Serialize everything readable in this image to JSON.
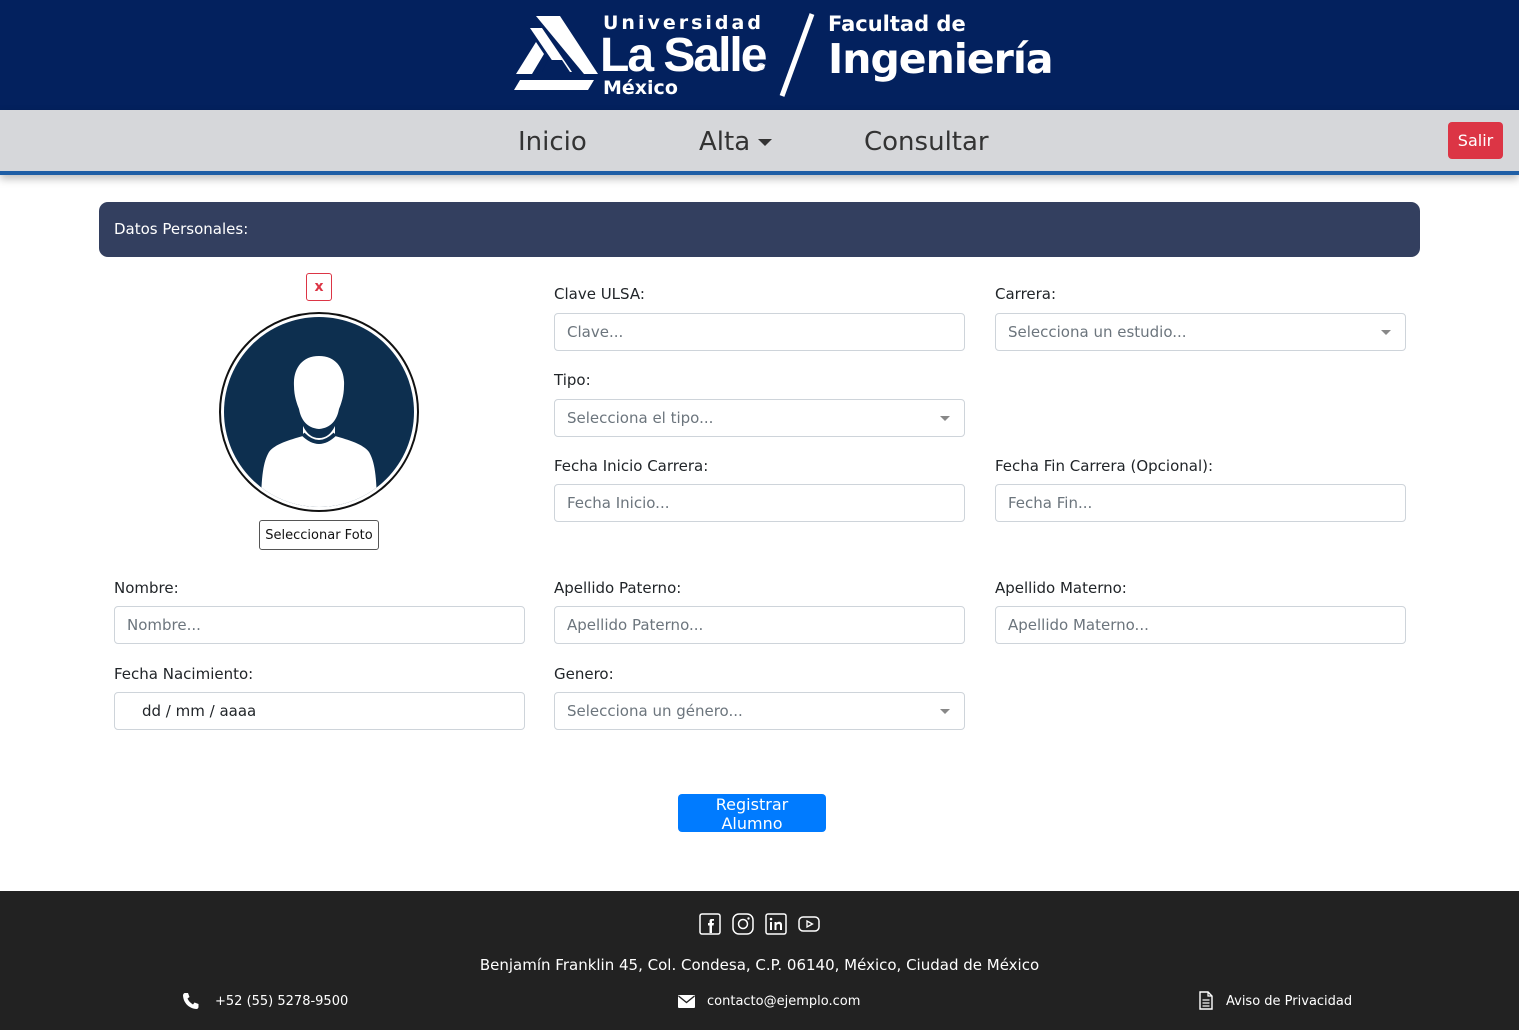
{
  "header": {
    "logo": {
      "universidad": "Universidad",
      "lasalle": "La Salle",
      "mexico": "México",
      "facultad": "Facultad de",
      "ingenieria": "Ingeniería"
    },
    "colors": {
      "background": "#03215e"
    }
  },
  "nav": {
    "items": [
      {
        "label": "Inicio"
      },
      {
        "label": "Alta",
        "has_dropdown": true
      },
      {
        "label": "Consultar"
      }
    ],
    "logout_label": "Salir"
  },
  "section": {
    "title": "Datos Personales:"
  },
  "photo": {
    "remove_label": "x",
    "select_label": "Seleccionar Foto",
    "avatar_icon": "user-silhouette-icon"
  },
  "form": {
    "clave": {
      "label": "Clave ULSA:",
      "placeholder": "Clave..."
    },
    "carrera": {
      "label": "Carrera:",
      "placeholder": "Selecciona un estudio..."
    },
    "tipo": {
      "label": "Tipo:",
      "placeholder": "Selecciona el tipo..."
    },
    "fecha_inicio": {
      "label": "Fecha Inicio Carrera:",
      "placeholder": "Fecha Inicio..."
    },
    "fecha_fin": {
      "label": "Fecha Fin Carrera (Opcional):",
      "placeholder": "Fecha Fin..."
    },
    "nombre": {
      "label": "Nombre:",
      "placeholder": "Nombre..."
    },
    "apellido_paterno": {
      "label": "Apellido Paterno:",
      "placeholder": "Apellido Paterno..."
    },
    "apellido_materno": {
      "label": "Apellido Materno:",
      "placeholder": "Apellido Materno..."
    },
    "fecha_nacimiento": {
      "label": "Fecha Nacimiento:",
      "value": "dd / mm / aaaa"
    },
    "genero": {
      "label": "Genero:",
      "placeholder": "Selecciona un género..."
    },
    "submit_label": "Registrar Alumno"
  },
  "footer": {
    "social_icons": [
      "facebook-icon",
      "instagram-icon",
      "linkedin-icon",
      "youtube-icon"
    ],
    "address": "Benjamín Franklin 45, Col. Condesa, C.P. 06140, México, Ciudad de México",
    "phone": "+52 (55) 5278-9500",
    "email": "contacto@ejemplo.com",
    "privacy": "Aviso de Privacidad"
  },
  "colors": {
    "section_header": "#333f5f",
    "primary": "#007bff",
    "danger": "#dc3545",
    "footer": "#222222",
    "avatar": "#0d2f4f"
  }
}
